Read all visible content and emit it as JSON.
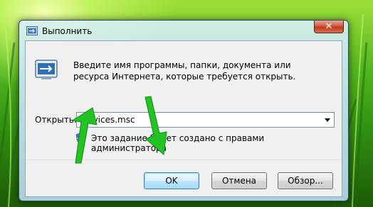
{
  "window": {
    "title": "Выполнить",
    "close_glyph": "✕",
    "icon": "run-app-icon"
  },
  "dialog": {
    "description": "Введите имя программы, папки, документа или ресурса Интернета, которые требуется открыть.",
    "open_label": "Открыть:",
    "open_value": "services.msc",
    "admin_note": "Это задание будет создано с правами администратора"
  },
  "buttons": {
    "ok": "OK",
    "cancel": "Отмена",
    "browse": "Обзор..."
  },
  "annotations": {
    "arrow_color": "#22c322",
    "arrow_count": 2
  }
}
